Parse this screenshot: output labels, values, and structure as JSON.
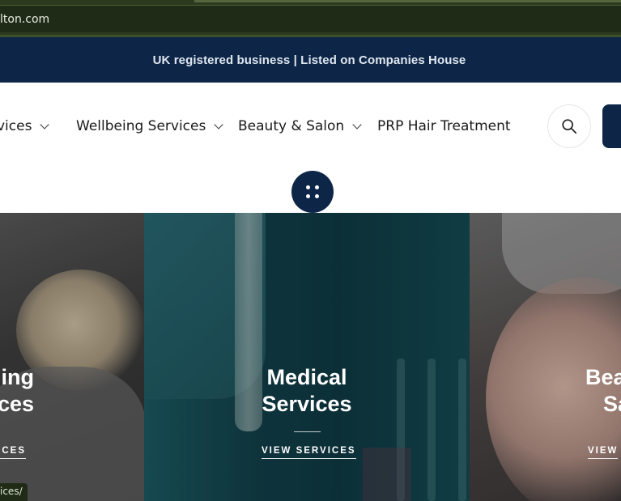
{
  "browser": {
    "url_fragment": "lton.com",
    "status_url_fragment": "ices/"
  },
  "banner": {
    "text": "UK registered business | Listed on Companies House"
  },
  "nav": {
    "items": [
      {
        "label": "rvices",
        "has_dropdown": true
      },
      {
        "label": "Wellbeing Services",
        "has_dropdown": true
      },
      {
        "label": "Beauty & Salon",
        "has_dropdown": true
      },
      {
        "label": "PRP Hair Treatment",
        "has_dropdown": false
      }
    ],
    "search_icon": "search-icon"
  },
  "panels": [
    {
      "title_line1": "ing",
      "title_line2": "ces",
      "link": "ICES"
    },
    {
      "title_line1": "Medical",
      "title_line2": "Services",
      "link": "VIEW SERVICES"
    },
    {
      "title_line1": "Bea",
      "title_line2": "Sa",
      "link": "VIEW"
    }
  ],
  "colors": {
    "navy": "#0d2647",
    "address_bar": "#2c3b1f",
    "white": "#ffffff"
  }
}
